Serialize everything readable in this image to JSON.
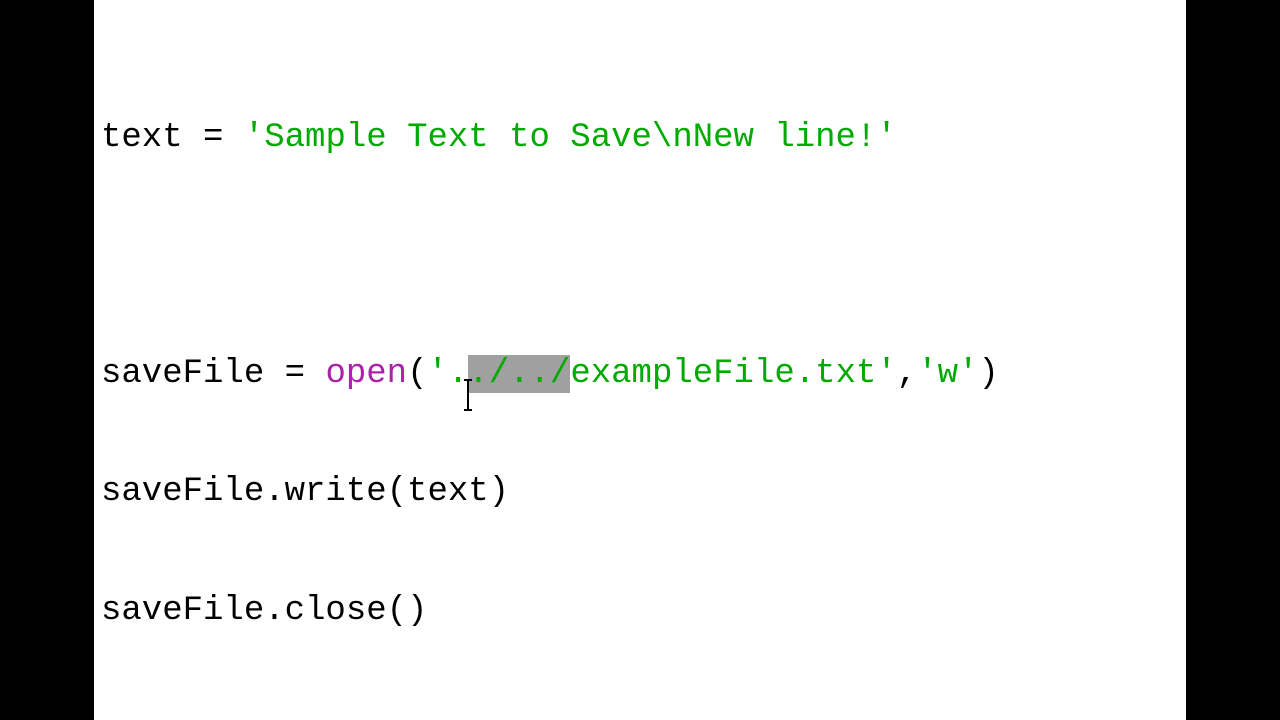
{
  "code": {
    "line1": {
      "var": "text",
      "op": " = ",
      "string": "'Sample Text to Save\\nNew line!'"
    },
    "line2": {
      "var": "saveFile",
      "op": " = ",
      "func": "open",
      "paren_open": "(",
      "str_prefix": "'",
      "str_dot": ".",
      "str_selected": "./../",
      "str_rest": "exampleFile.txt'",
      "comma": ",",
      "mode": "'w'",
      "paren_close": ")"
    },
    "line3": {
      "text": "saveFile.write(text)"
    },
    "line4": {
      "text": "saveFile.close()"
    }
  },
  "colors": {
    "string": "#00aa00",
    "keyword": "#aa22aa",
    "selection": "#a0a0a0",
    "background": "#ffffff",
    "border": "#000000"
  },
  "icons": {
    "cursor": "text-ibeam-cursor-icon"
  }
}
